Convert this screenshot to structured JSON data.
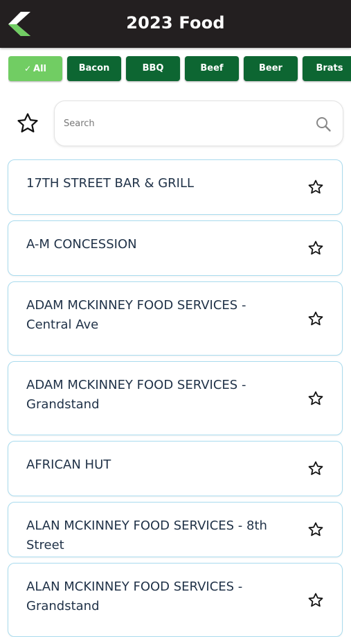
{
  "header": {
    "title": "2023 Food"
  },
  "filters": [
    {
      "label": "All",
      "active": true
    },
    {
      "label": "Bacon",
      "active": false
    },
    {
      "label": "BBQ",
      "active": false
    },
    {
      "label": "Beef",
      "active": false
    },
    {
      "label": "Beer",
      "active": false
    },
    {
      "label": "Brats",
      "active": false
    }
  ],
  "search": {
    "placeholder": "Search",
    "value": ""
  },
  "vendors": [
    "17TH STREET BAR & GRILL",
    "A-M CONCESSION",
    "ADAM MCKINNEY FOOD SERVICES - Central Ave",
    "ADAM MCKINNEY FOOD SERVICES - Grandstand",
    "AFRICAN HUT",
    "ALAN MCKINNEY FOOD SERVICES - 8th Street",
    "ALAN MCKINNEY FOOD SERVICES - Grandstand"
  ],
  "colors": {
    "header_bg": "#231f20",
    "chip_bg": "#0d6632",
    "chip_active_bg": "#71cd63",
    "card_border": "#a9dbee",
    "logo_white": "#ffffff",
    "logo_green": "#71cd63"
  },
  "icons": {
    "back": "back-chevron-icon",
    "favorite_filter": "star-outline-icon",
    "search": "search-icon",
    "favorite": "star-outline-icon"
  }
}
